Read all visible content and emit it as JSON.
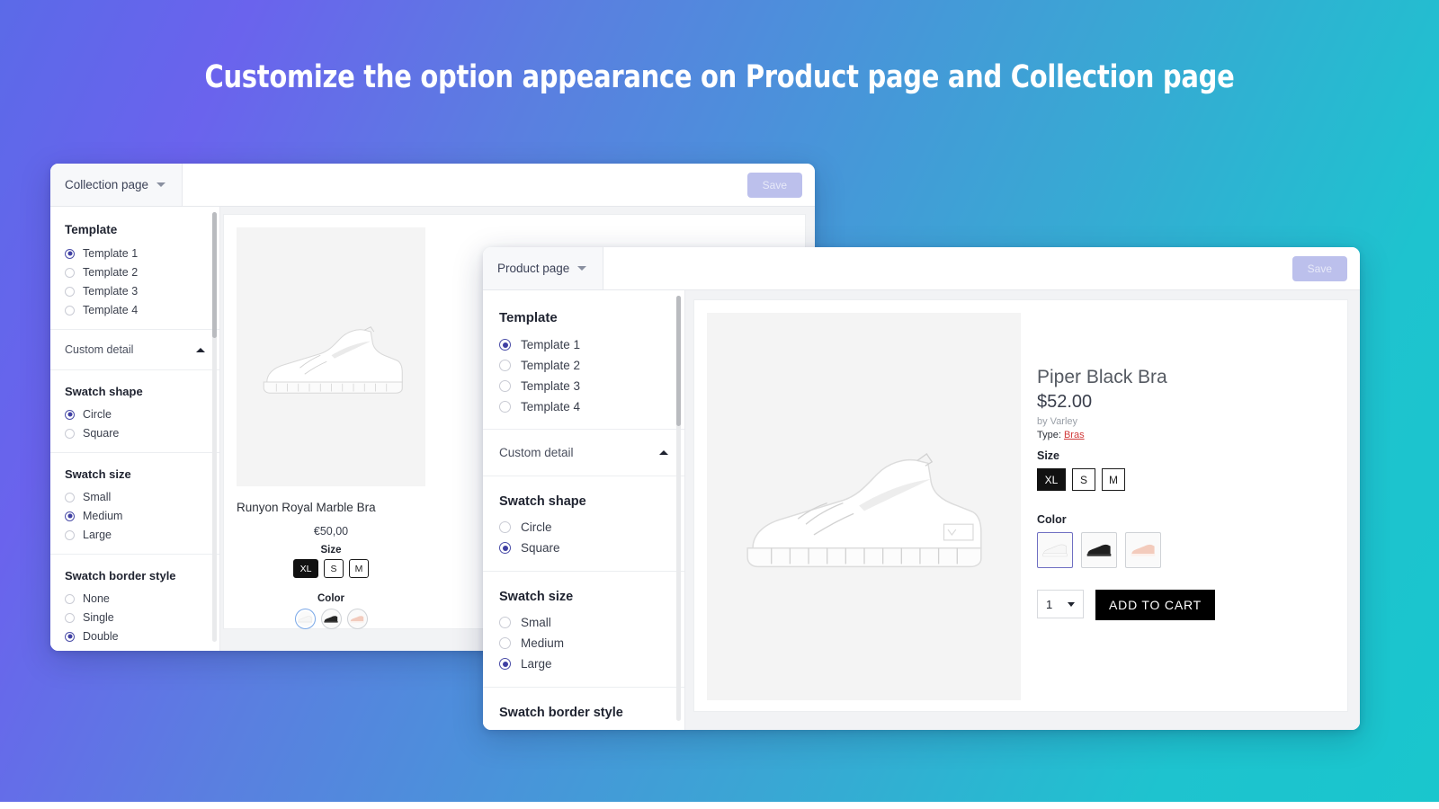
{
  "headline": "Customize the option appearance on Product page and Collection page",
  "theme": {
    "bg_left": "#5b6ae8",
    "bg_right": "#19c6cd",
    "accent_radio": "#3f3fa3",
    "save_bg": "#bcc0ec",
    "save_text": "#e7e9f8"
  },
  "collection_panel": {
    "tab_label": "Collection page",
    "save_label": "Save",
    "settings": {
      "template": {
        "title": "Template",
        "options": [
          "Template 1",
          "Template 2",
          "Template 3",
          "Template 4"
        ],
        "selected": "Template 1"
      },
      "custom_detail": {
        "label": "Custom detail",
        "expanded": true
      },
      "swatch_shape": {
        "title": "Swatch shape",
        "options": [
          "Circle",
          "Square"
        ],
        "selected": "Circle"
      },
      "swatch_size": {
        "title": "Swatch size",
        "options": [
          "Small",
          "Medium",
          "Large"
        ],
        "selected": "Medium"
      },
      "swatch_border_style": {
        "title": "Swatch border style",
        "options": [
          "None",
          "Single",
          "Double"
        ],
        "selected": "Double"
      }
    },
    "preview": {
      "product_title": "Runyon Royal Marble Bra",
      "price": "€50,00",
      "size_label": "Size",
      "sizes": [
        "XL",
        "S",
        "M"
      ],
      "size_selected": "XL",
      "color_label": "Color",
      "colors": [
        "white-shoe-swatch",
        "black-shoe-swatch",
        "pink-shoe-swatch"
      ],
      "color_selected": "white-shoe-swatch"
    }
  },
  "product_panel": {
    "tab_label": "Product page",
    "save_label": "Save",
    "settings": {
      "template": {
        "title": "Template",
        "options": [
          "Template 1",
          "Template 2",
          "Template 3",
          "Template 4"
        ],
        "selected": "Template 1"
      },
      "custom_detail": {
        "label": "Custom detail",
        "expanded": true
      },
      "swatch_shape": {
        "title": "Swatch shape",
        "options": [
          "Circle",
          "Square"
        ],
        "selected": "Square"
      },
      "swatch_size": {
        "title": "Swatch size",
        "options": [
          "Small",
          "Medium",
          "Large"
        ],
        "selected": "Large"
      },
      "swatch_border_style": {
        "title": "Swatch border style"
      }
    },
    "preview": {
      "product_title": "Piper Black Bra",
      "price": "$52.00",
      "vendor": "by Varley",
      "type_prefix": "Type:",
      "type_value": "Bras",
      "size_label": "Size",
      "sizes": [
        "XL",
        "S",
        "M"
      ],
      "size_selected": "XL",
      "color_label": "Color",
      "colors": [
        "white-shoe-swatch",
        "black-shoe-swatch",
        "pink-shoe-swatch"
      ],
      "color_selected": "white-shoe-swatch",
      "quantity_value": "1",
      "add_to_cart_label": "ADD TO CART"
    }
  }
}
